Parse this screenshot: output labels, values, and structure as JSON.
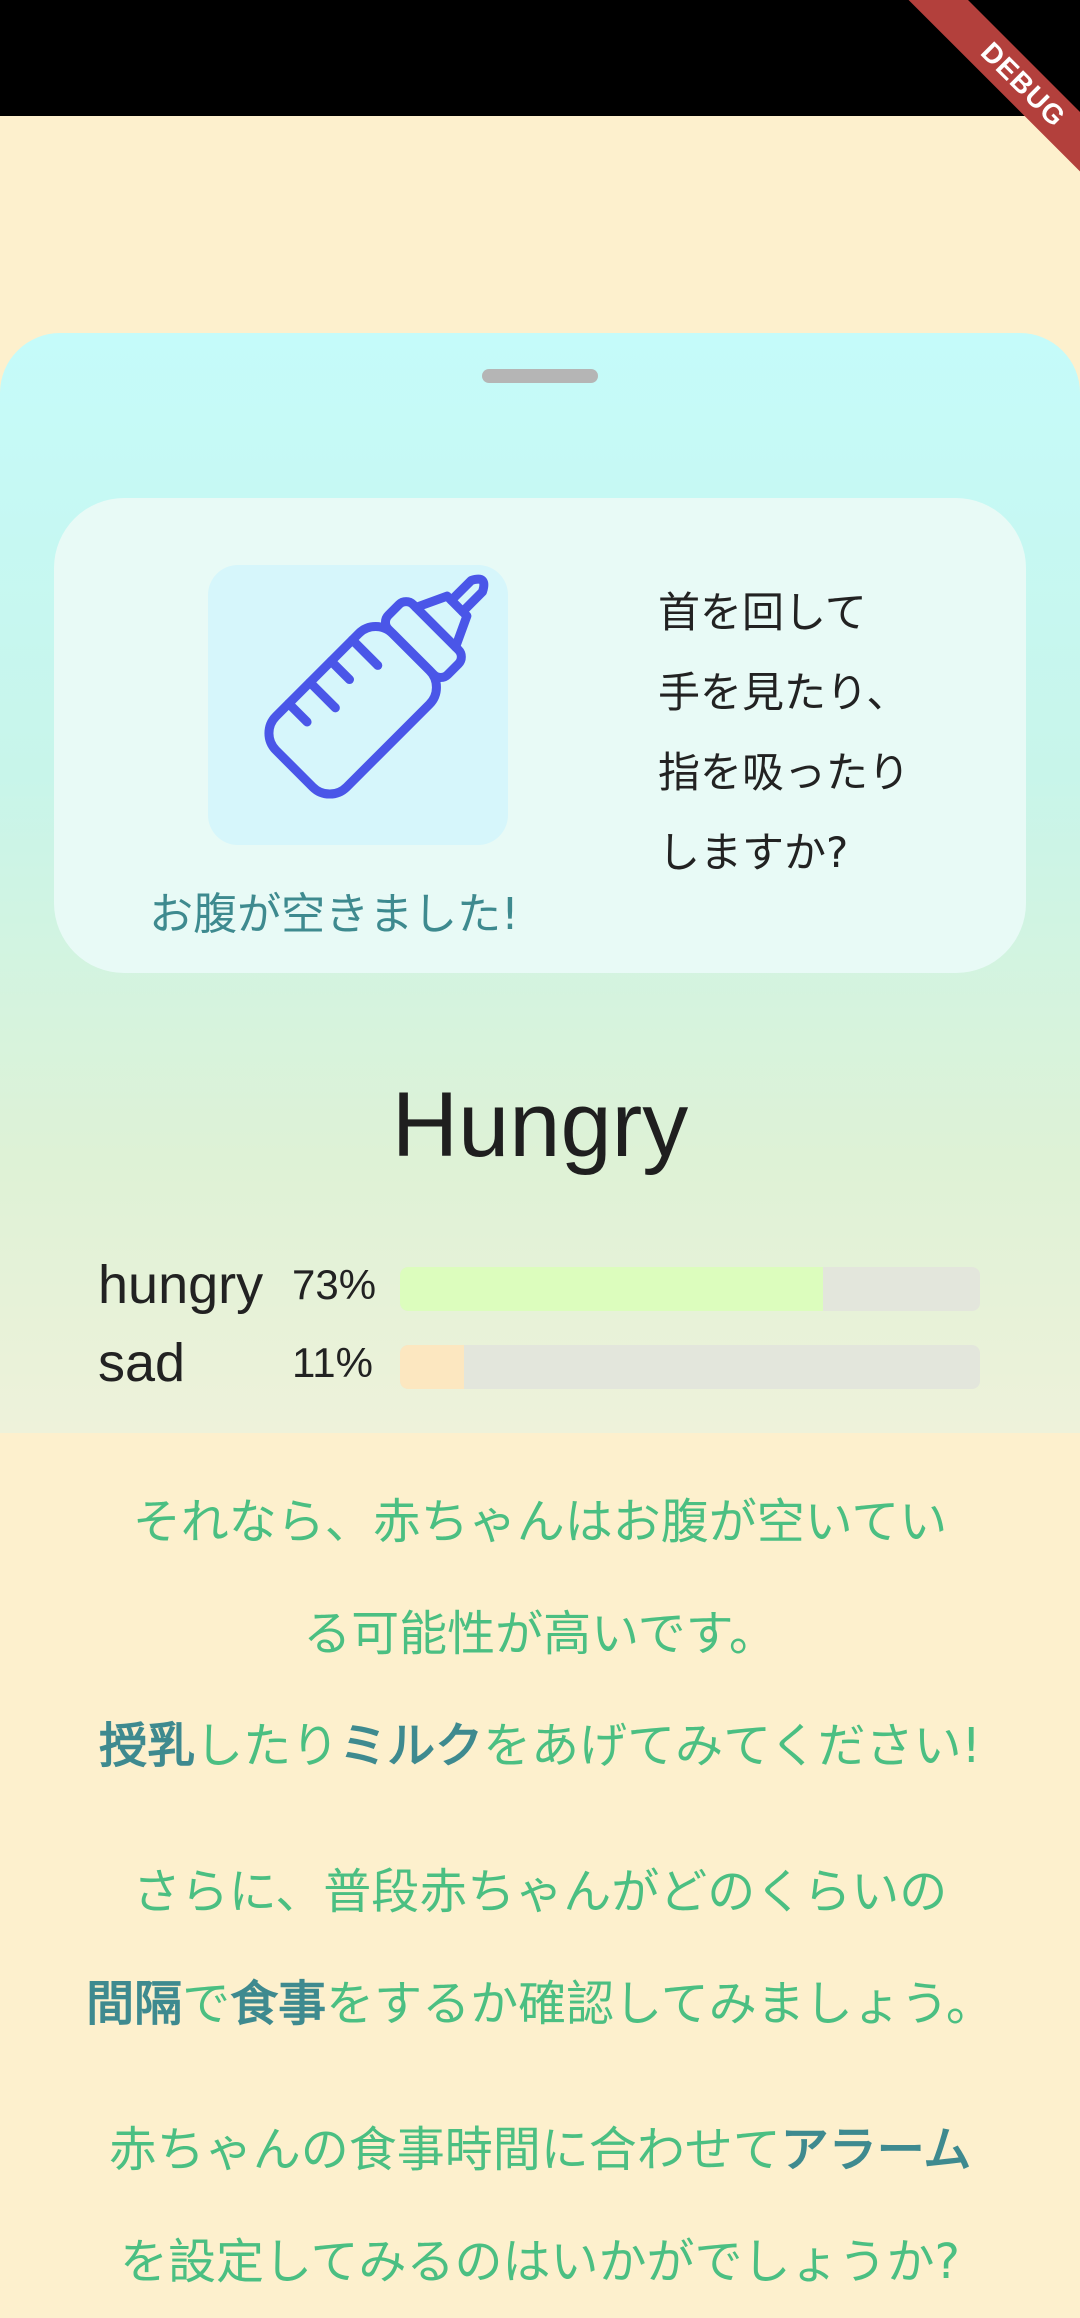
{
  "debug_banner": "DEBUG",
  "card": {
    "icon": "baby-bottle-icon",
    "caption": "お腹が空きました!",
    "lines": [
      "首を回して",
      "手を見たり、",
      "指を吸ったり",
      "しますか?"
    ]
  },
  "mood_title": "Hungry",
  "moods": [
    {
      "label": "hungry",
      "pct_text": "73%",
      "value": 0.73,
      "color": "#dcfdbd"
    },
    {
      "label": "sad",
      "pct_text": "11%",
      "value": 0.11,
      "color": "#fce7c0"
    }
  ],
  "advice": {
    "p1_line1": "それなら、赤ちゃんはお腹が空いてい",
    "p1_line2": "る可能性が高いです。",
    "p2_b1": "授乳",
    "p2_t1": "したり",
    "p2_b2": "ミルク",
    "p2_t2": "をあげてみてください!",
    "p3_line1": "さらに、普段赤ちゃんがどのくらいの",
    "p3_b1": "間隔",
    "p3_t1": "で",
    "p3_b2": "食事",
    "p3_t2": "をするか確認してみましょう。",
    "p4_t1": "赤ちゃんの食事時間に合わせて",
    "p4_b1": "アラーム",
    "p4_line2": "を設定してみるのはいかがでしょうか?"
  },
  "colors": {
    "accent_green": "#4bbf82",
    "accent_teal": "#3e8a8f",
    "icon_blue": "#4a56e8"
  }
}
